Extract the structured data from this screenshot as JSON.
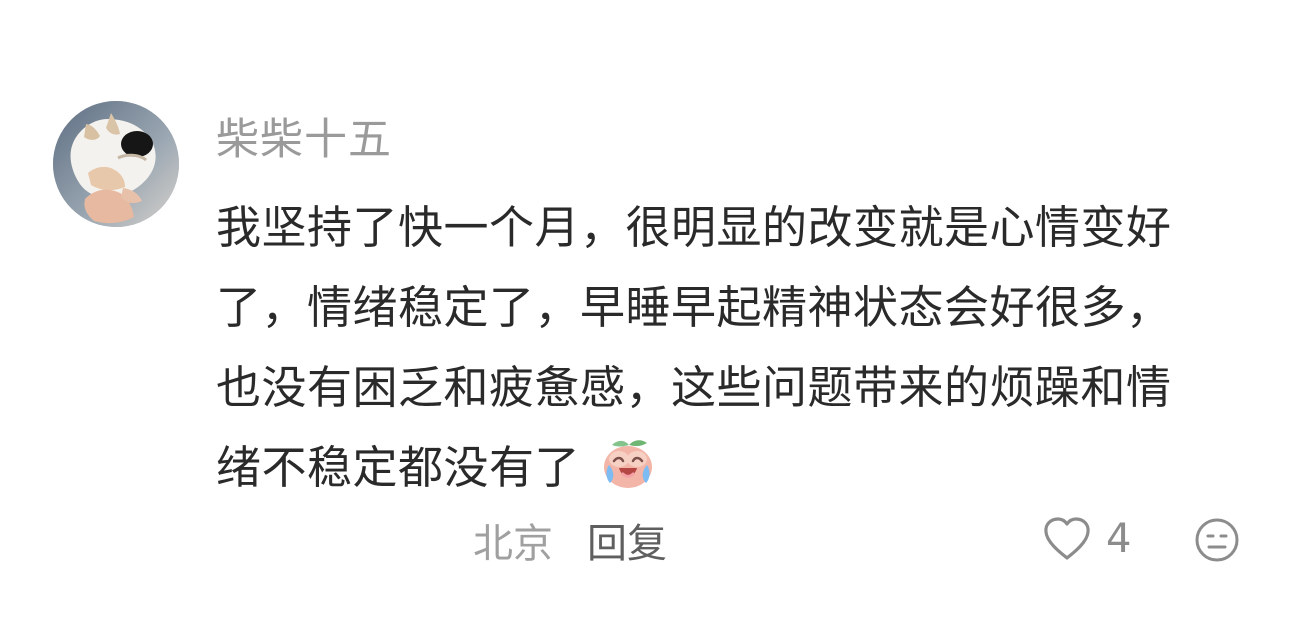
{
  "comment": {
    "avatar_icon": "avatar-photo",
    "username": "柴柴十五",
    "content_lines": [
      "我坚持了快一个月，很明显的改变就是心情变好",
      "了，情绪稳定了，早睡早起精神状态会好很多，",
      "也没有困乏和疲惫感，这些问题带来的烦躁和情",
      "绪不稳定都没有了"
    ],
    "emoji_icon": "crying-laughing-peach-emoji",
    "location": "北京",
    "reply_label": "回复",
    "like_icon": "heart-icon",
    "like_count": "4",
    "dislike_icon": "dislike-face-icon"
  },
  "colors": {
    "username": "#9a9a9a",
    "content": "#2a2a2a",
    "location": "#a0a0a0",
    "reply": "#5f5f5f",
    "icon": "#8c8c8c"
  }
}
